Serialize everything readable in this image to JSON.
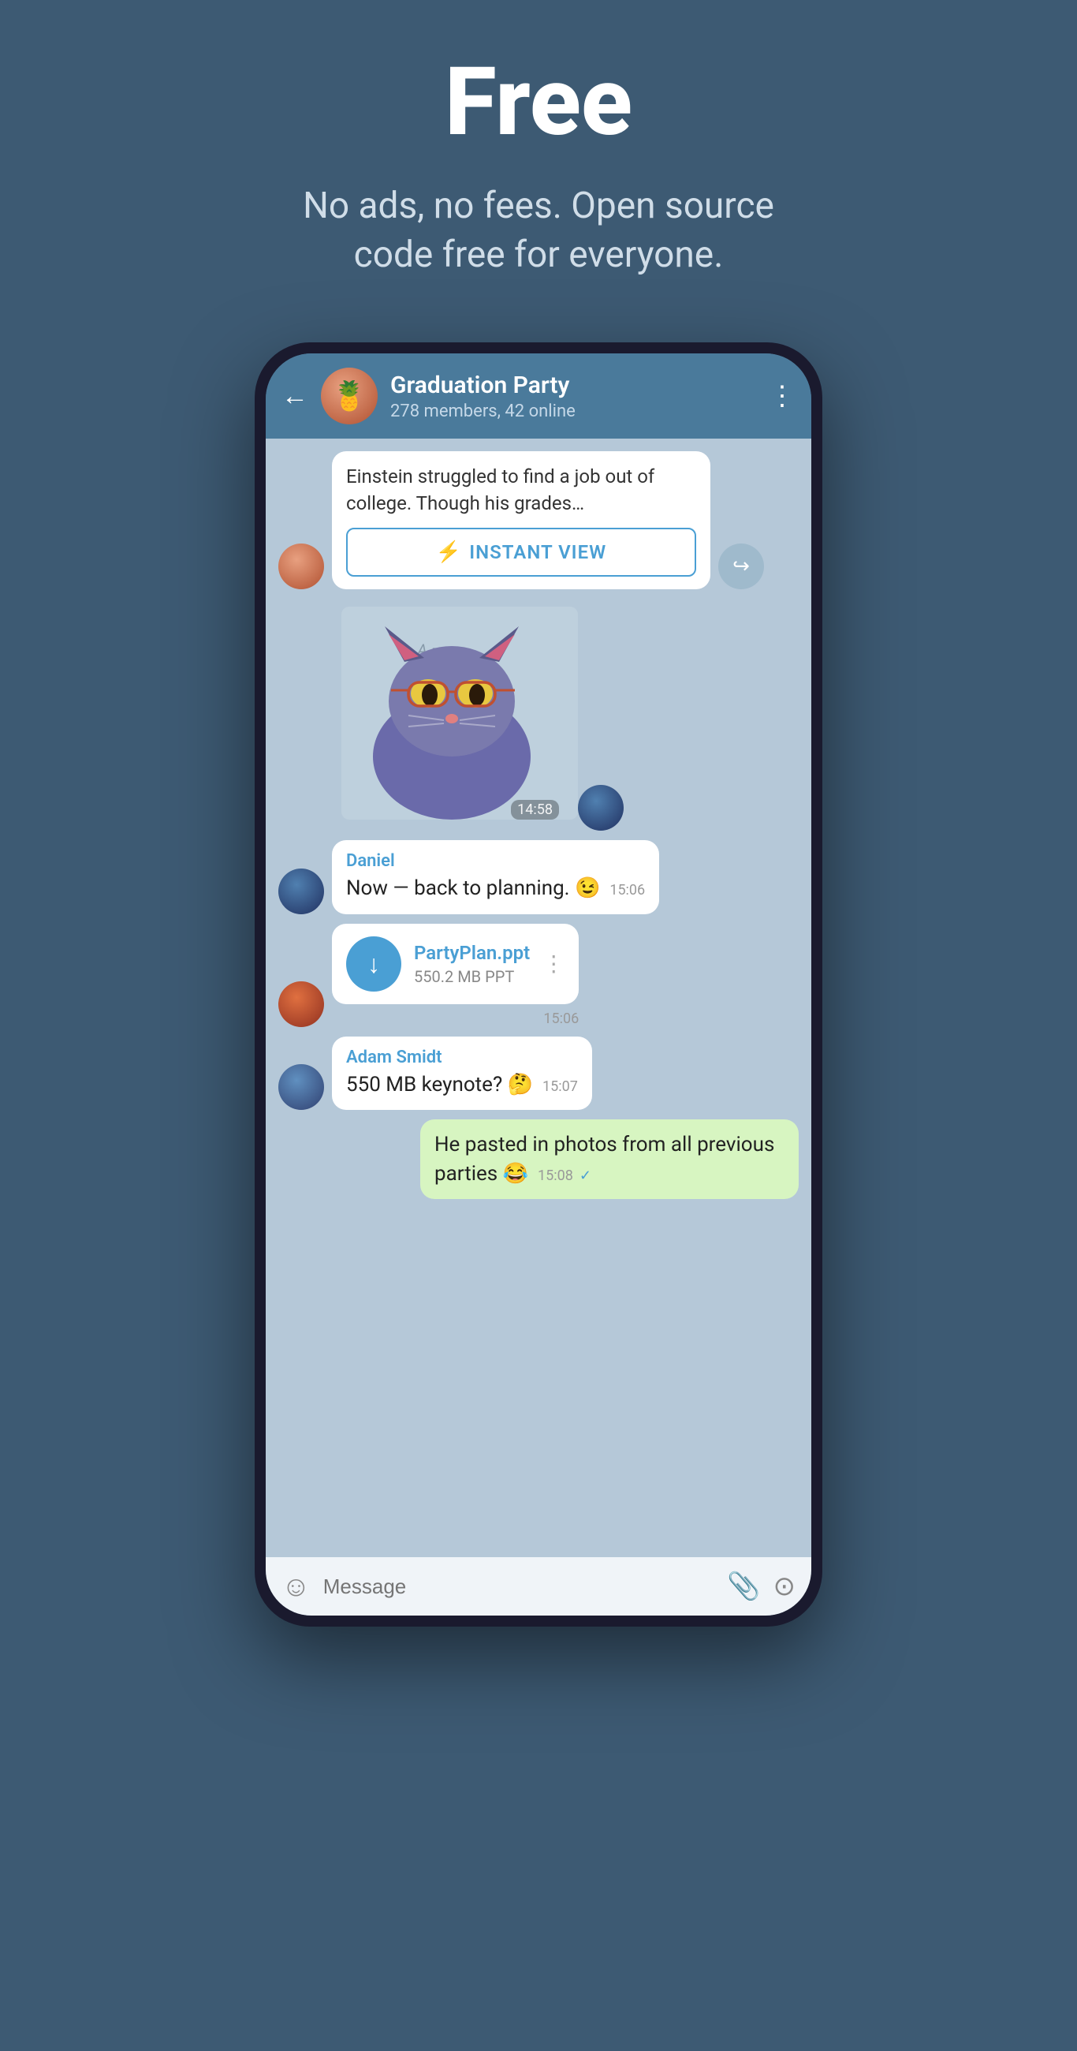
{
  "hero": {
    "title": "Free",
    "subtitle": "No ads, no fees. Open source code free for everyone."
  },
  "chat": {
    "back_icon": "←",
    "group_avatar_emoji": "🍍",
    "group_name": "Graduation Party",
    "group_meta": "278 members, 42 online",
    "more_icon": "⋮",
    "instant_view": {
      "article_text": "Einstein struggled to find a job out of college. Though his grades…",
      "button_label": "INSTANT VIEW",
      "lightning": "⚡"
    },
    "sticker_time": "14:58",
    "messages": [
      {
        "sender": "Daniel",
        "text": "Now — back to planning. 😉",
        "time": "15:06",
        "avatar_type": "male1",
        "type": "text"
      },
      {
        "sender": "",
        "file_name": "PartyPlan.ppt",
        "file_size": "550.2 MB PPT",
        "time": "15:06",
        "avatar_type": "male2",
        "type": "file"
      },
      {
        "sender": "Adam Smidt",
        "text": "550 MB keynote? 🤔",
        "time": "15:07",
        "avatar_type": "male3",
        "type": "text"
      },
      {
        "sender": "",
        "text": "He pasted in photos from all previous parties 😂",
        "time": "15:08",
        "tick": "✓",
        "type": "self",
        "bubble_color": "green"
      }
    ],
    "input": {
      "placeholder": "Message",
      "emoji_icon": "☺",
      "attach_icon": "📎",
      "camera_icon": "⊙"
    }
  }
}
